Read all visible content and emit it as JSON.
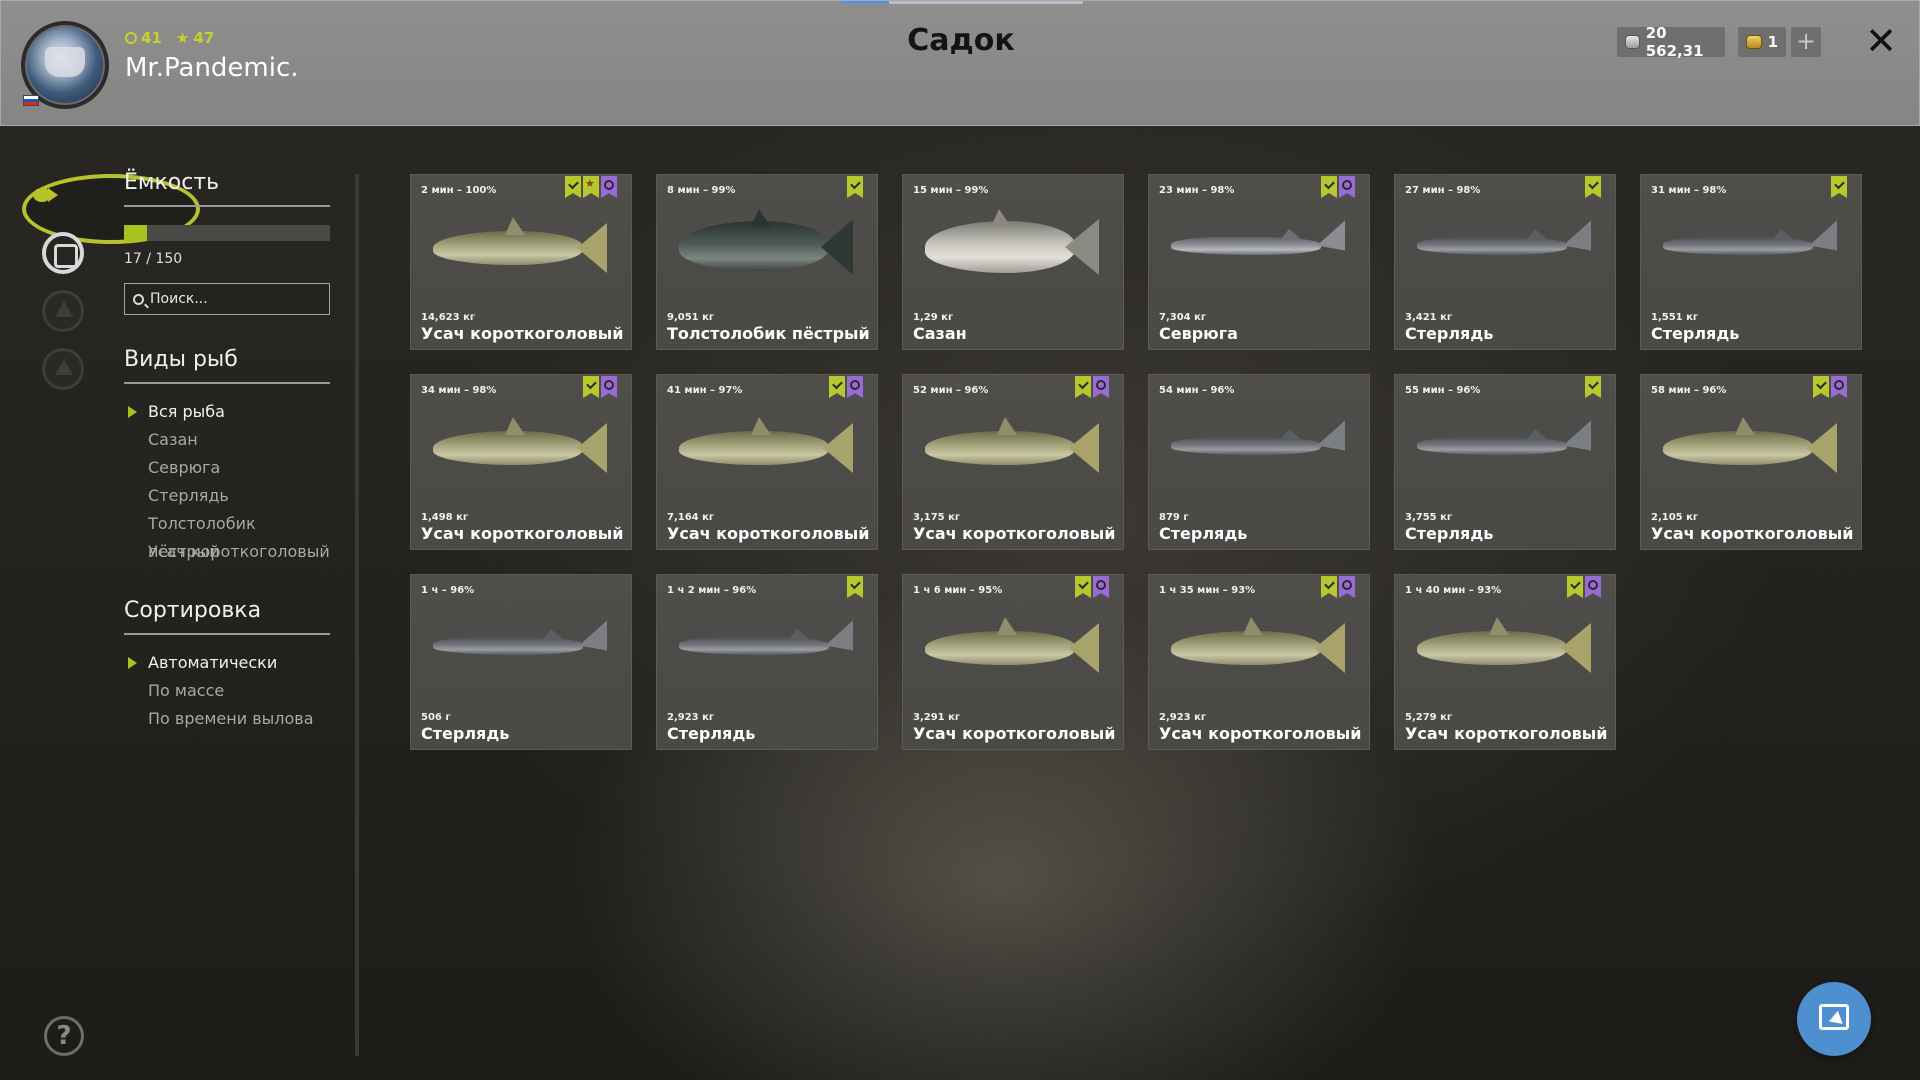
{
  "header": {
    "title": "Садок",
    "username": "Mr.Pandemic.",
    "stat_level": "41",
    "stat_rank": "47",
    "silver": "20 562,31",
    "gold": "1",
    "plus_label": "+",
    "close_label": "✕"
  },
  "capacity": {
    "title": "Ёмкость",
    "fill_fraction": 0.113,
    "text": "17 / 150"
  },
  "search": {
    "placeholder": "Поиск..."
  },
  "species": {
    "title": "Виды рыб",
    "items": [
      {
        "label": "Вся рыба",
        "active": true
      },
      {
        "label": "Сазан",
        "active": false
      },
      {
        "label": "Севрюга",
        "active": false
      },
      {
        "label": "Стерлядь",
        "active": false
      },
      {
        "label": "Толстолобик пёстрый",
        "active": false
      },
      {
        "label": "Усач короткоголовый",
        "active": false
      }
    ]
  },
  "sort": {
    "title": "Сортировка",
    "items": [
      {
        "label": "Автоматически",
        "active": true
      },
      {
        "label": "По массе",
        "active": false
      },
      {
        "label": "По времени вылова",
        "active": false
      }
    ]
  },
  "fish": [
    {
      "time": "2 мин – 100%",
      "weight": "14,623 кг",
      "name": "Усач короткоголовый",
      "kind": "barbel",
      "badges": [
        "green-check",
        "green-star",
        "purple-award"
      ]
    },
    {
      "time": "8 мин – 99%",
      "weight": "9,051 кг",
      "name": "Толстолобик пёстрый",
      "kind": "bighead",
      "badges": [
        "green-check"
      ]
    },
    {
      "time": "15 мин – 99%",
      "weight": "1,29 кг",
      "name": "Сазан",
      "kind": "carp",
      "badges": []
    },
    {
      "time": "23 мин – 98%",
      "weight": "7,304 кг",
      "name": "Севрюга",
      "kind": "sturgeon",
      "badges": [
        "green-check",
        "purple-award"
      ]
    },
    {
      "time": "27 мин – 98%",
      "weight": "3,421 кг",
      "name": "Стерлядь",
      "kind": "sterlet",
      "badges": [
        "green-check"
      ]
    },
    {
      "time": "31 мин – 98%",
      "weight": "1,551 кг",
      "name": "Стерлядь",
      "kind": "sterlet",
      "badges": [
        "green-check"
      ]
    },
    {
      "time": "34 мин – 98%",
      "weight": "1,498 кг",
      "name": "Усач короткоголовый",
      "kind": "barbel",
      "badges": [
        "green-check",
        "purple-award"
      ]
    },
    {
      "time": "41 мин – 97%",
      "weight": "7,164 кг",
      "name": "Усач короткоголовый",
      "kind": "barbel",
      "badges": [
        "green-check",
        "purple-award"
      ]
    },
    {
      "time": "52 мин – 96%",
      "weight": "3,175 кг",
      "name": "Усач короткоголовый",
      "kind": "barbel",
      "badges": [
        "green-check",
        "purple-award"
      ]
    },
    {
      "time": "54 мин – 96%",
      "weight": "879 г",
      "name": "Стерлядь",
      "kind": "sterlet",
      "badges": []
    },
    {
      "time": "55 мин – 96%",
      "weight": "3,755 кг",
      "name": "Стерлядь",
      "kind": "sterlet",
      "badges": [
        "green-check"
      ]
    },
    {
      "time": "58 мин – 96%",
      "weight": "2,105 кг",
      "name": "Усач короткоголовый",
      "kind": "barbel",
      "badges": [
        "green-check",
        "purple-award"
      ]
    },
    {
      "time": "1 ч – 96%",
      "weight": "506 г",
      "name": "Стерлядь",
      "kind": "sterlet",
      "badges": []
    },
    {
      "time": "1 ч 2 мин – 96%",
      "weight": "2,923 кг",
      "name": "Стерлядь",
      "kind": "sterlet",
      "badges": [
        "green-check"
      ]
    },
    {
      "time": "1 ч 6 мин – 95%",
      "weight": "3,291 кг",
      "name": "Усач короткоголовый",
      "kind": "barbel",
      "badges": [
        "green-check",
        "purple-award"
      ]
    },
    {
      "time": "1 ч 35 мин – 93%",
      "weight": "2,923 кг",
      "name": "Усач короткоголовый",
      "kind": "barbel",
      "badges": [
        "green-check",
        "purple-award"
      ]
    },
    {
      "time": "1 ч 40 мин – 93%",
      "weight": "5,279 кг",
      "name": "Усач короткоголовый",
      "kind": "barbel",
      "badges": [
        "green-check",
        "purple-award"
      ]
    }
  ],
  "help_label": "?",
  "colors": {
    "accent": "#a9c21f",
    "badge_green": "#b6c82b",
    "badge_purple": "#9a6bd6",
    "fab": "#4e8fd0"
  }
}
